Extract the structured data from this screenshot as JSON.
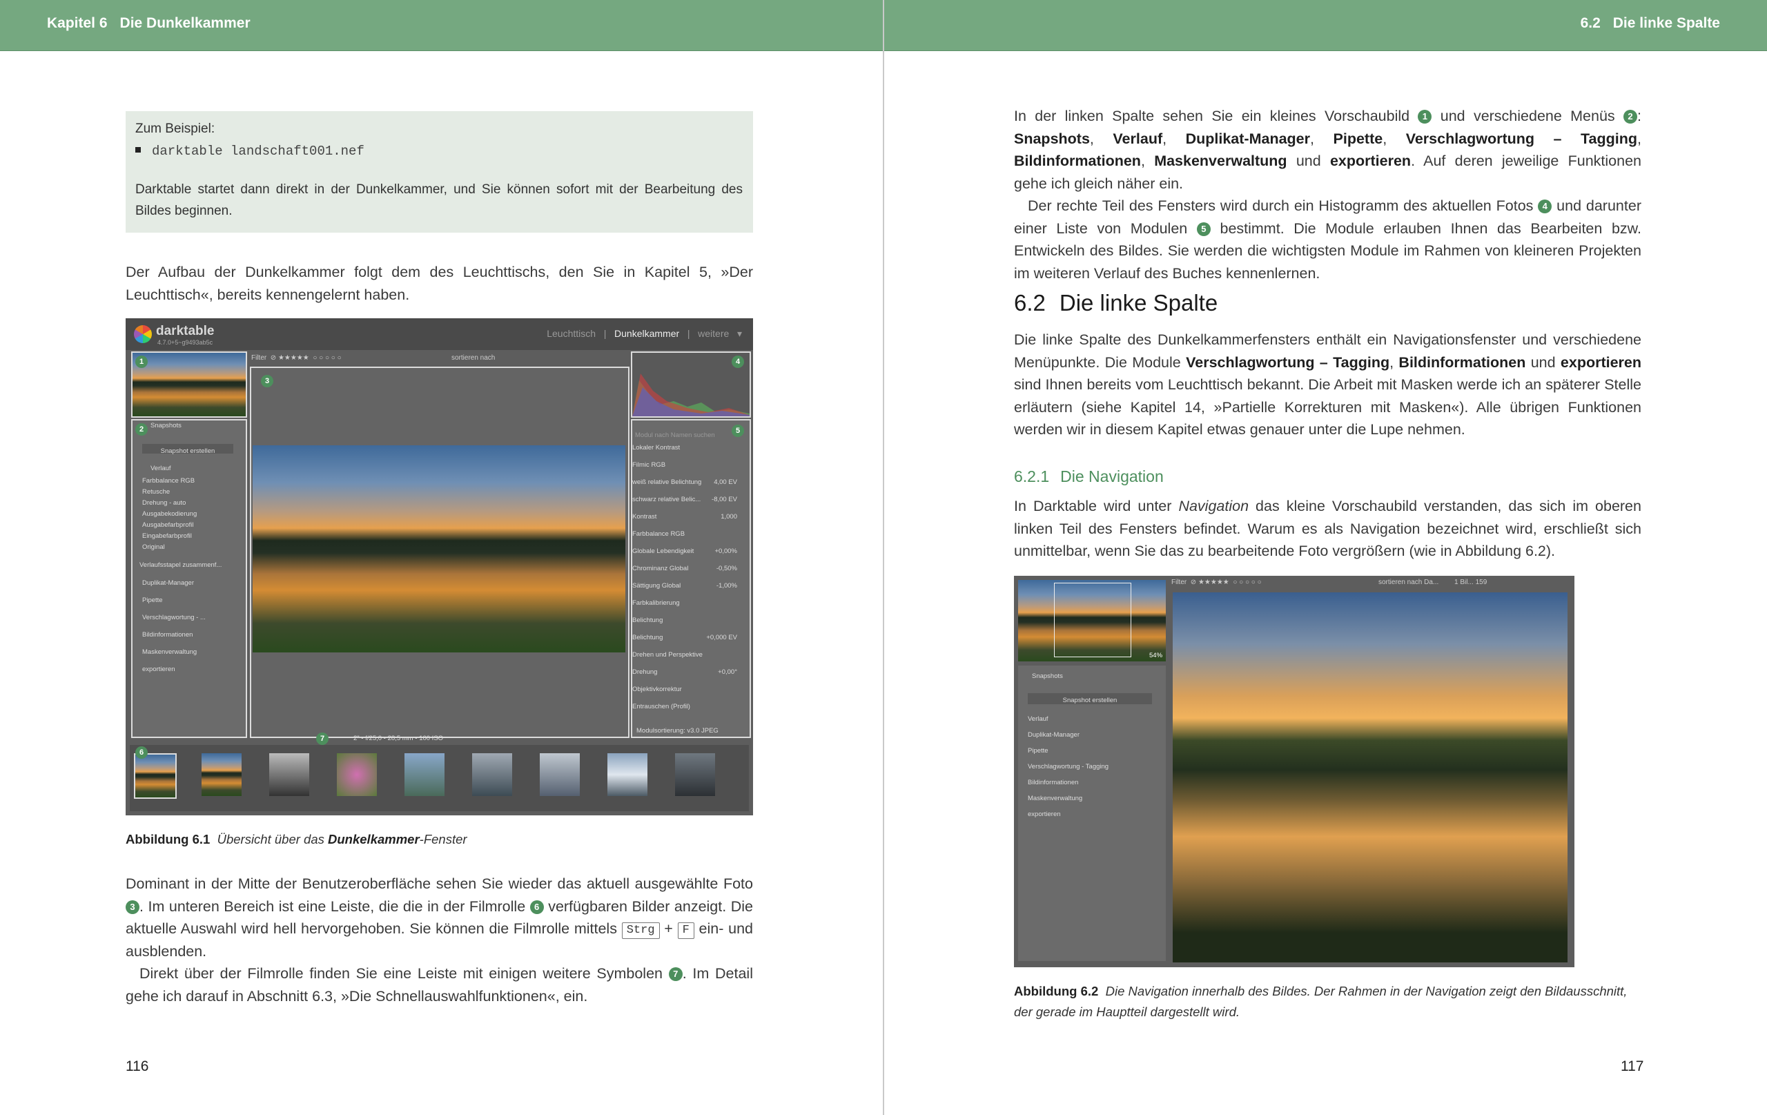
{
  "left_page": {
    "header": {
      "chapter": "Kapitel 6",
      "title": "Die Dunkelkammer"
    },
    "example_box": {
      "intro": "Zum Beispiel:",
      "code": "darktable landschaft001.nef",
      "text": "Darktable startet dann direkt in der Dunkelkammer, und Sie können sofort mit der Bearbeitung des Bildes beginnen."
    },
    "para1": "Der Aufbau der Dunkelkammer folgt dem des Leuchttischs, den Sie in Kapitel 5, »Der Leuchttisch«, bereits kennengelernt haben.",
    "figure1": {
      "caption_label": "Abbildung 6.1",
      "caption_pre": "Übersicht über das",
      "caption_bold": "Dunkelkammer",
      "caption_post": "-Fenster",
      "ui": {
        "app_name": "darktable",
        "app_version": "4.7.0+5~g9493ab5c",
        "view_lighttable": "Leuchttisch",
        "view_darkroom": "Dunkelkammer",
        "view_more": "weitere",
        "filter_label": "Filter",
        "sort_label": "sortieren nach",
        "snapshots_header": "Snapshots",
        "snapshot_button": "Snapshot erstellen",
        "history_header": "Verlauf",
        "history_items": [
          "Farbbalance RGB",
          "Retusche",
          "Drehung - auto",
          "Ausgabekodierung",
          "Ausgabefarbprofil",
          "Eingabefarbprofil",
          "Original"
        ],
        "history_compress": "Verlaufsstapel zusammenf...",
        "left_modules": [
          "Duplikat-Manager",
          "Pipette",
          "Verschlagwortung - ...",
          "Bildinformationen",
          "Maskenverwaltung",
          "exportieren"
        ],
        "right_search": "Modul nach Namen suchen",
        "right_modules": [
          {
            "name": "Lokaler Kontrast"
          },
          {
            "name": "Filmic RGB"
          },
          {
            "name": "weiß relative Belichtung",
            "value": "4,00 EV"
          },
          {
            "name": "schwarz relative Belic...",
            "value": "-8,00 EV"
          },
          {
            "name": "Kontrast",
            "value": "1,000"
          },
          {
            "name": "Farbbalance RGB"
          },
          {
            "name": "Globale Lebendigkeit",
            "value": "+0,00%"
          },
          {
            "name": "Chrominanz Global",
            "value": "-0,50%"
          },
          {
            "name": "Sättigung Global",
            "value": "-1,00%"
          },
          {
            "name": "Farbkalibrierung"
          },
          {
            "name": "Belichtung"
          },
          {
            "name": "Belichtung",
            "value": "+0,000 EV"
          },
          {
            "name": "Drehen und Perspektive"
          },
          {
            "name": "Drehung",
            "value": "+0,00°"
          },
          {
            "name": "Objektivkorrektur"
          },
          {
            "name": "Entrauschen (Profil)"
          }
        ],
        "module_order": "Modulsortierung: v3.0 JPEG",
        "exif": "2\" • f/25,0 • 28,5 mm • 100 ISO",
        "markers": [
          "1",
          "2",
          "3",
          "4",
          "5",
          "6",
          "7"
        ]
      }
    },
    "para2": {
      "t1": "Dominant in der Mitte der Benutzeroberfläche sehen Sie wieder das aktuell ausgewählte Foto",
      "n3": "3",
      "t2": ". Im unteren Bereich ist eine Leiste, die die in der Filmrolle",
      "n6": "6",
      "t3": "verfügbaren Bilder anzeigt. Die aktuelle Auswahl wird hell hervorgehoben. Sie können die Filmrolle mittels",
      "key1": "Strg",
      "plus": "+",
      "key2": "F",
      "t4": "ein- und ausblenden."
    },
    "para3": {
      "t1": "Direkt über der Filmrolle finden Sie eine Leiste mit einigen weitere Symbolen",
      "n7": "7",
      "t2": ". Im Detail gehe ich darauf in Abschnitt 6.3, »Die Schnellauswahlfunktionen«, ein."
    },
    "page_number": "116"
  },
  "right_page": {
    "header": {
      "section": "6.2",
      "title": "Die linke Spalte"
    },
    "para1": {
      "t1": "In der linken Spalte sehen Sie ein kleines Vorschaubild",
      "n1": "1",
      "t2": "und verschiedene Menüs",
      "n2": "2",
      "t3": ":",
      "b1": "Snapshots",
      "t4": ",",
      "b2": "Verlauf",
      "t5": ",",
      "b3": "Duplikat-Manager",
      "t6": ",",
      "b4": "Pipette",
      "t7": ",",
      "b5": "Verschlagwortung – Tagging",
      "t8": ",",
      "b6": "Bildinformationen",
      "t9": ",",
      "b7": "Maskenverwaltung",
      "t10": "und",
      "b8": "exportieren",
      "t11": ". Auf deren jeweilige Funktionen gehe ich gleich näher ein."
    },
    "para2": {
      "t1": "Der rechte Teil des Fensters wird durch ein Histogramm des aktuellen Fotos",
      "n4": "4",
      "t2": "und darunter einer Liste von Modulen",
      "n5": "5",
      "t3": "bestimmt. Die Module erlauben Ihnen das Bearbeiten bzw. Entwickeln des Bildes. Sie werden die wichtigsten Module im Rahmen von kleineren Projekten im weiteren Verlauf des Buches kennenlernen."
    },
    "heading2": {
      "number": "6.2",
      "title": "Die linke Spalte"
    },
    "para3": {
      "t1": "Die linke Spalte des Dunkelkammerfensters enthält ein Navigationsfenster und verschiedene Menüpunkte. Die Module",
      "b1": "Verschlagwortung – Tagging",
      "t2": ",",
      "b2": "Bildinformationen",
      "t3": "und",
      "b3": "exportieren",
      "t4": "sind Ihnen bereits vom Leuchttisch bekannt. Die Arbeit mit Masken werde ich an späterer Stelle erläutern (siehe Kapitel 14, »Partielle Korrekturen mit Masken«). Alle übrigen Funktionen werden wir in diesem Kapitel etwas genauer unter die Lupe nehmen."
    },
    "heading3": {
      "number": "6.2.1",
      "title": "Die Navigation"
    },
    "para4": {
      "t1": "In Darktable wird unter",
      "i1": "Navigation",
      "t2": "das kleine Vorschaubild verstanden, das sich im oberen linken Teil des Fensters befindet. Warum es als Navigation bezeichnet wird, erschließt sich unmittelbar, wenn Sie das zu bearbeitende Foto vergrößern (wie in Abbildung 6.2)."
    },
    "figure2": {
      "caption_label": "Abbildung 6.2",
      "caption_text": "Die Navigation innerhalb des Bildes. Der Rahmen in der Navigation zeigt den Bildausschnitt, der gerade im Hauptteil dargestellt wird.",
      "ui": {
        "zoom": "54%",
        "filter_label": "Filter",
        "sort_label": "sortieren nach Da...",
        "count": "1 Bil... 159",
        "snapshots_header": "Snapshots",
        "snapshot_button": "Snapshot erstellen",
        "modules": [
          "Verlauf",
          "Duplikat-Manager",
          "Pipette",
          "Verschlagwortung - Tagging",
          "Bildinformationen",
          "Maskenverwaltung",
          "exportieren"
        ]
      }
    },
    "page_number": "117"
  }
}
